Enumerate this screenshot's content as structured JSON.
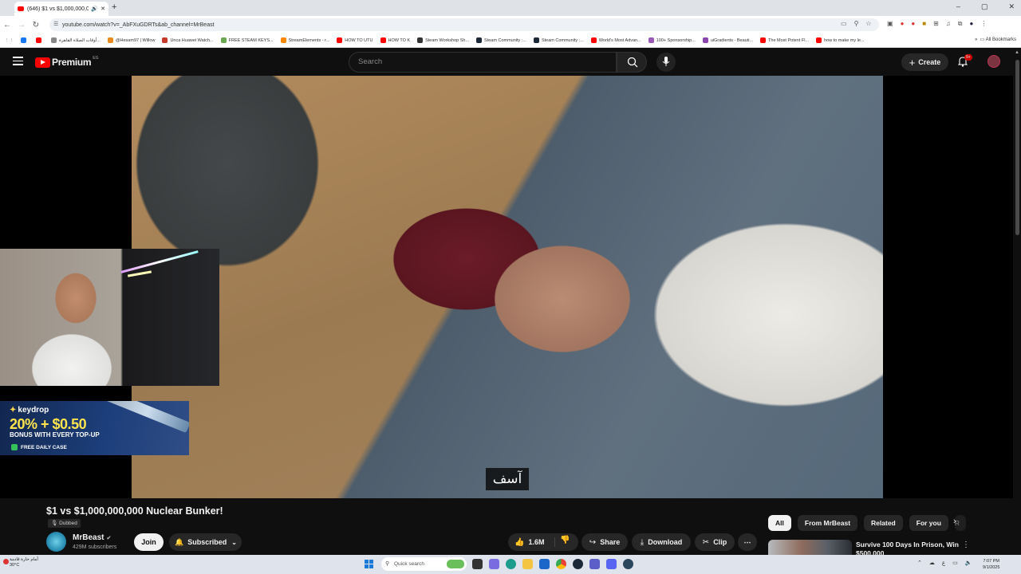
{
  "browser": {
    "tab_title": "(646) $1 vs $1,000,000,000",
    "url": "youtube.com/watch?v=_AbFXuGDRTs&ab_channel=MrBeast",
    "bookmarks": [
      {
        "label": "",
        "color": "#1877f2"
      },
      {
        "label": "",
        "color": "#ff0000"
      },
      {
        "label": "أوقات الصلاة القاهرة...",
        "color": "#888888"
      },
      {
        "label": "@Hesam97 | Willow",
        "color": "#e78a1f"
      },
      {
        "label": "Unca Huawei Watch...",
        "color": "#c53929"
      },
      {
        "label": "FREE STEAM KEYS...",
        "color": "#6aa84f"
      },
      {
        "label": "StreamElements - r...",
        "color": "#ff8a00"
      },
      {
        "label": "HOW TO UTU",
        "color": "#ff0000"
      },
      {
        "label": "HOW TO K",
        "color": "#ff0000"
      },
      {
        "label": "Steam Workshop Sh...",
        "color": "#333333"
      },
      {
        "label": "Steam Community :...",
        "color": "#1b2838"
      },
      {
        "label": "Steam Community :...",
        "color": "#1b2838"
      },
      {
        "label": "World's Most Advan...",
        "color": "#ff0000"
      },
      {
        "label": "100+ Sponsorship...",
        "color": "#9b59b6"
      },
      {
        "label": "uiGradients - Beauti...",
        "color": "#8e44ad"
      },
      {
        "label": "The Most Potent Fl...",
        "color": "#ff0000"
      },
      {
        "label": "how to make my le...",
        "color": "#ff0000"
      }
    ],
    "all_bookmarks": "All Bookmarks"
  },
  "header": {
    "logo_text": "Premium",
    "country": "EG",
    "search_placeholder": "Search",
    "create_label": "Create",
    "notifications": "9+"
  },
  "video": {
    "subtitle": "آسف",
    "title": "$1 vs $1,000,000,000 Nuclear Bunker!",
    "dubbed": "Dubbed",
    "channel": "MrBeast",
    "subscribers": "429M subscribers",
    "join": "Join",
    "subscribed": "Subscribed",
    "likes": "1.6M",
    "share": "Share",
    "download": "Download",
    "clip": "Clip"
  },
  "overlay_ad": {
    "brand": "keydrop",
    "big": "20% + $0.50",
    "line": "BONUS WITH EVERY TOP-UP",
    "case": "FREE DAILY CASE"
  },
  "chips": [
    "All",
    "From MrBeast",
    "Related",
    "For you",
    "R"
  ],
  "recommended": {
    "title": "Survive 100 Days In Prison, Win",
    "title2": "$500,000"
  },
  "taskbar": {
    "weather": "أمام حارة قادمة",
    "temp": "30°C",
    "search": "Quick search",
    "time": "7:07 PM",
    "date": "9/1/2025",
    "lang": "ع"
  }
}
